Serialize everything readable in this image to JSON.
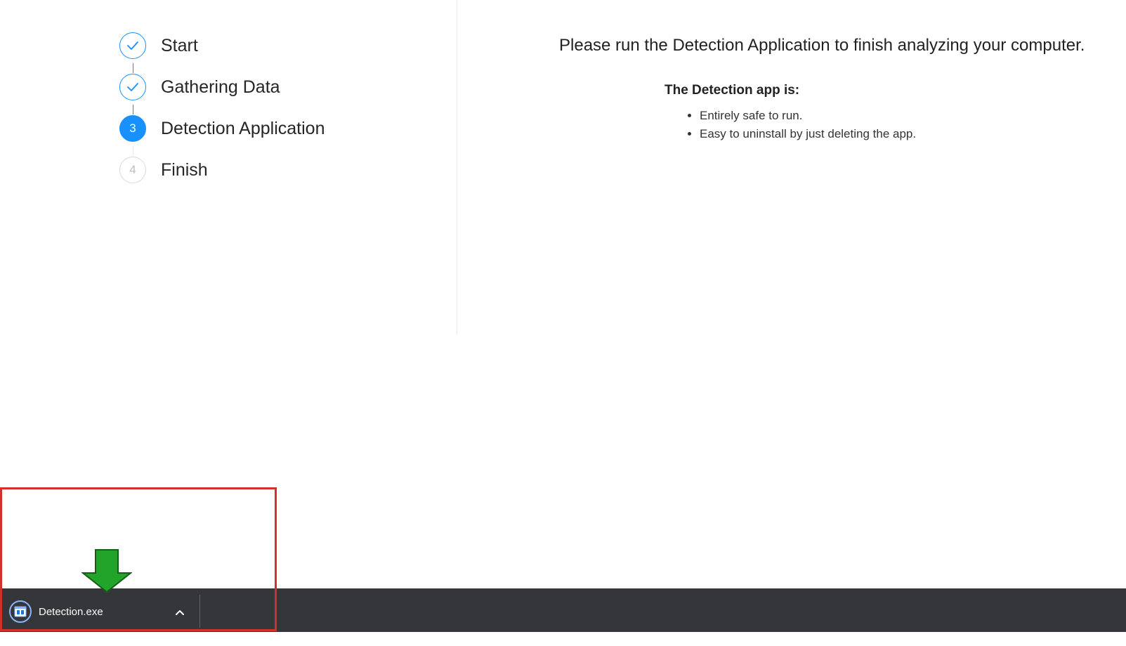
{
  "steps": [
    {
      "label": "Start",
      "state": "done",
      "number": "1"
    },
    {
      "label": "Gathering Data",
      "state": "done",
      "number": "2"
    },
    {
      "label": "Detection Application",
      "state": "active",
      "number": "3"
    },
    {
      "label": "Finish",
      "state": "pending",
      "number": "4"
    }
  ],
  "main": {
    "heading": "Please run the Detection Application to finish analyzing your computer.",
    "info_title": "The Detection app is:",
    "bullets": [
      "Entirely safe to run.",
      "Easy to uninstall by just deleting the app."
    ]
  },
  "download_bar": {
    "filename": "Detection.exe",
    "file_icon": "executable-file-icon",
    "expand_icon": "chevron-up-icon"
  },
  "overlay": {
    "arrow_icon": "down-arrow-icon",
    "arrow_color": "#22a32a",
    "highlight_color": "#d32f2f"
  },
  "colors": {
    "accent": "#1890ff",
    "bar_background": "#35363a"
  }
}
